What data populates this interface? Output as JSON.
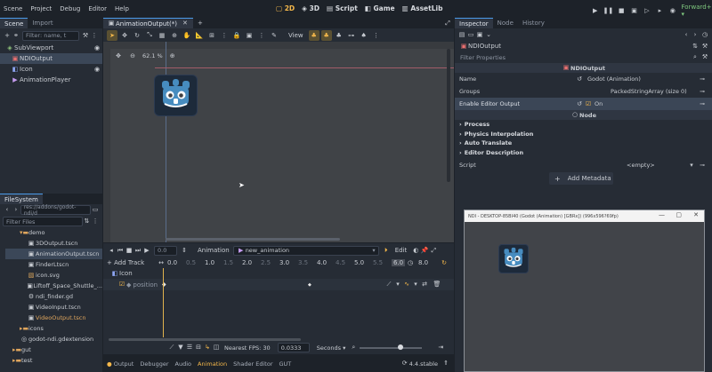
{
  "menu": [
    "Scene",
    "Project",
    "Debug",
    "Editor",
    "Help"
  ],
  "modes": {
    "m2d": "2D",
    "m3d": "3D",
    "script": "Script",
    "game": "Game",
    "assetlib": "AssetLib"
  },
  "renderer": "Forward+",
  "scene_dock": {
    "tabs": [
      "Scene",
      "Import"
    ],
    "filter_placeholder": "Filter: name, t",
    "nodes": [
      "SubViewport",
      "NDIOutput",
      "Icon",
      "AnimationPlayer"
    ]
  },
  "filesystem": {
    "title": "FileSystem",
    "path": "res://addons/godot-ndi/d",
    "filter_placeholder": "Filter Files",
    "items": [
      "demo",
      "3DOutput.tscn",
      "AnimationOutput.tscn",
      "FinderLtscn",
      "icon.svg",
      "Liftoff_Space_Shuttle_...",
      "ndi_finder.gd",
      "VideoInput.tscn",
      "VideoOutput.tscn",
      "icons",
      "godot-ndi.gdextension",
      "gut",
      "test"
    ]
  },
  "editor_tab": "AnimationOutput(*)",
  "viewport": {
    "view_label": "View",
    "zoom": "62.1 %"
  },
  "animation": {
    "time": "0.0",
    "label": "Animation",
    "anim_name": "new_animation",
    "edit": "Edit",
    "length": "8.0",
    "add_track": "Add Track",
    "ticks": [
      "0.0",
      "0.5",
      "1.0",
      "1.5",
      "2.0",
      "2.5",
      "3.0",
      "3.5",
      "4.0",
      "4.5",
      "5.0",
      "5.5",
      "6.0"
    ],
    "track_node": "Icon",
    "track_prop": "position",
    "fps_label": "Nearest FPS: 30",
    "step": "0.0333",
    "unit": "Seconds"
  },
  "bottom_tabs": [
    "Output",
    "Debugger",
    "Audio",
    "Animation",
    "Shader Editor",
    "GUT"
  ],
  "version": "4.4.stable",
  "inspector": {
    "tabs": [
      "Inspector",
      "Node",
      "History"
    ],
    "node_name": "NDIOutput",
    "filter_placeholder": "Filter Properties",
    "class_header": "NDIOutput",
    "name_label": "Name",
    "name_value": "Godot (Animation)",
    "groups_label": "Groups",
    "groups_value": "PackedStringArray (size 0)",
    "enable_label": "Enable Editor Output",
    "enable_value": "On",
    "node_header": "Node",
    "sections": [
      "Process",
      "Physics Interpolation",
      "Auto Translate",
      "Editor Description"
    ],
    "script_label": "Script",
    "script_value": "<empty>",
    "add_metadata": "Add Metadata"
  },
  "ndi_window": {
    "title": "NDI - DESKTOP-85BI40 (Godot (Animation) [GBRx]) (996x596?69fp)"
  }
}
